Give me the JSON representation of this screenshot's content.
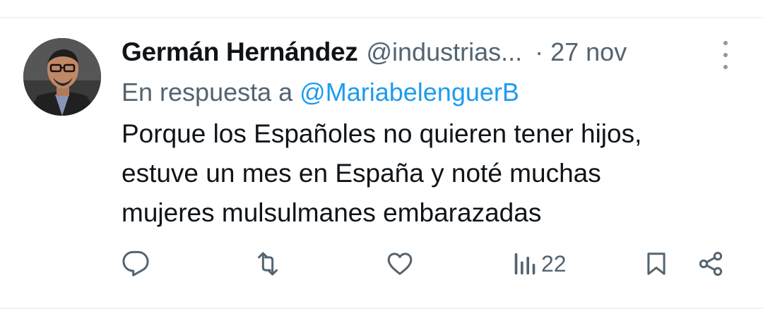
{
  "tweet": {
    "display_name": "Germán Hernández",
    "handle": "@industrias...",
    "separator": "·",
    "date": "27 nov",
    "reply_prefix": "En respuesta a",
    "reply_mention": "@MariabelenguerB",
    "text_lines": [
      "Porque los Españoles no quieren tener hijos,",
      "estuve un mes en España y noté muchas",
      "mujeres mulsulmanes embarazadas"
    ]
  },
  "actions": {
    "reply_icon": "reply-icon",
    "retweet_icon": "retweet-icon",
    "like_icon": "like-icon",
    "views_icon": "views-icon",
    "views_count": "22",
    "bookmark_icon": "bookmark-icon",
    "share_icon": "share-icon"
  },
  "colors": {
    "text": "#0f1419",
    "secondary": "#536471",
    "link": "#1d9bf0",
    "border": "#eff3f4"
  }
}
